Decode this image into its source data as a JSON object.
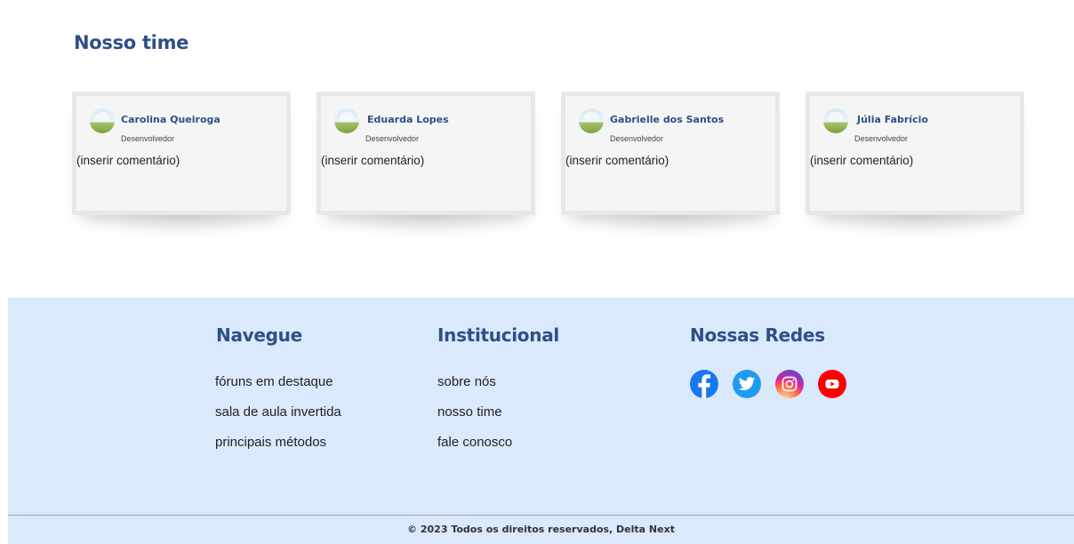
{
  "team": {
    "title": "Nosso time",
    "members": [
      {
        "name": "Carolina Queiroga",
        "role": "Desenvolvedor",
        "comment": "(inserir comentário)"
      },
      {
        "name": "Eduarda Lopes",
        "role": "Desenvolvedor",
        "comment": "(inserir comentário)"
      },
      {
        "name": "Gabrielle dos Santos",
        "role": "Desenvolvedor",
        "comment": "(inserir comentário)"
      },
      {
        "name": "Júlia Fabrício",
        "role": "Desenvolvedor",
        "comment": "(inserir comentário)"
      }
    ]
  },
  "footer": {
    "navegue": {
      "title": "Navegue",
      "links": [
        "fóruns em destaque",
        "sala de aula invertida",
        "principais métodos"
      ]
    },
    "institucional": {
      "title": "Institucional",
      "links": [
        "sobre nós",
        "nosso time",
        "fale conosco"
      ]
    },
    "redes": {
      "title": "Nossas Redes",
      "icons": [
        "facebook-icon",
        "twitter-icon",
        "instagram-icon",
        "youtube-icon"
      ]
    },
    "copyright": "© 2023 Todos os direitos reservados, Delta Next"
  },
  "colors": {
    "heading": "#2f4f85",
    "footer_bg": "#dae9fb",
    "facebook": "#1877f2",
    "twitter": "#1d9bf0",
    "instagram": "#e1306c",
    "youtube": "#ff0000"
  }
}
